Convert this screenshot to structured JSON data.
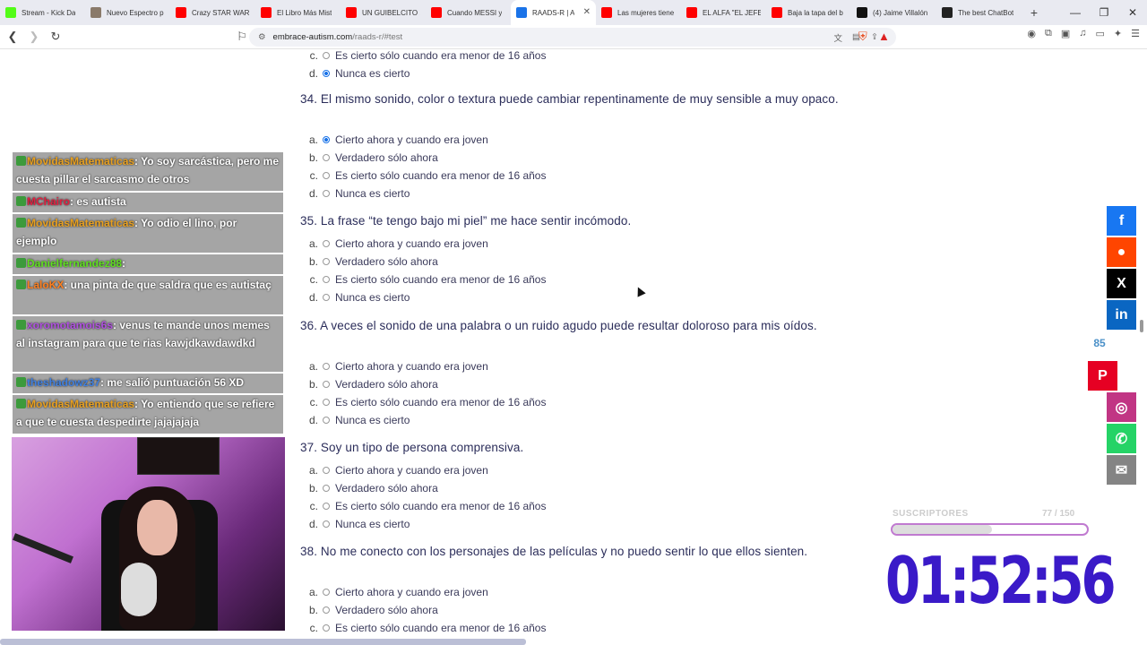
{
  "browser": {
    "tabs": [
      {
        "label": "Stream - Kick Da",
        "favicon_color": "#53fc18",
        "active": false
      },
      {
        "label": "Nuevo Espectro p",
        "favicon_color": "#8a7a6a",
        "active": false
      },
      {
        "label": "Crazy STAR WAR",
        "favicon_color": "#ff0000",
        "active": false
      },
      {
        "label": "El Libro Más Mist",
        "favicon_color": "#ff0000",
        "active": false
      },
      {
        "label": "UN GUIBELCITO !",
        "favicon_color": "#ff0000",
        "active": false
      },
      {
        "label": "Cuando MESSI y",
        "favicon_color": "#ff0000",
        "active": false
      },
      {
        "label": "RAADS-R | A",
        "favicon_color": "#1a73e8",
        "active": true
      },
      {
        "label": "Las mujeres tiene",
        "favicon_color": "#ff0000",
        "active": false
      },
      {
        "label": "EL ALFA \"EL JEFE\"",
        "favicon_color": "#ff0000",
        "active": false
      },
      {
        "label": "Baja la tapa del b",
        "favicon_color": "#ff0000",
        "active": false
      },
      {
        "label": "(4) Jaime Villalón",
        "favicon_color": "#111111",
        "active": false
      },
      {
        "label": "The best ChatBot",
        "favicon_color": "#222222",
        "active": false
      }
    ],
    "new_tab": "+",
    "window_buttons": [
      "—",
      "❐",
      "✕"
    ],
    "url_domain": "embrace-autism.com",
    "url_path": "/raads-r/#test"
  },
  "quiz": {
    "prev_options": [
      {
        "letter": "c.",
        "text": "Es cierto sólo cuando era menor de 16 años",
        "checked": false
      },
      {
        "letter": "d.",
        "text": "Nunca es cierto",
        "checked": true
      }
    ],
    "questions": [
      {
        "text": "34. El mismo sonido, color o textura puede cambiar repentinamente de muy sensible a muy opaco.",
        "options": [
          {
            "letter": "a.",
            "text": "Cierto ahora y cuando era joven",
            "checked": true
          },
          {
            "letter": "b.",
            "text": "Verdadero sólo ahora",
            "checked": false
          },
          {
            "letter": "c.",
            "text": "Es cierto sólo cuando era menor de 16 años",
            "checked": false
          },
          {
            "letter": "d.",
            "text": "Nunca es cierto",
            "checked": false
          }
        ]
      },
      {
        "text": "35. La frase “te tengo bajo mi piel” me hace sentir incómodo.",
        "options": [
          {
            "letter": "a.",
            "text": "Cierto ahora y cuando era joven",
            "checked": false
          },
          {
            "letter": "b.",
            "text": "Verdadero sólo ahora",
            "checked": false
          },
          {
            "letter": "c.",
            "text": "Es cierto sólo cuando era menor de 16 años",
            "checked": false
          },
          {
            "letter": "d.",
            "text": "Nunca es cierto",
            "checked": false
          }
        ]
      },
      {
        "text": "36. A veces el sonido de una palabra o un ruido agudo puede resultar doloroso para mis oídos.",
        "options": [
          {
            "letter": "a.",
            "text": "Cierto ahora y cuando era joven",
            "checked": false
          },
          {
            "letter": "b.",
            "text": "Verdadero sólo ahora",
            "checked": false
          },
          {
            "letter": "c.",
            "text": "Es cierto sólo cuando era menor de 16 años",
            "checked": false
          },
          {
            "letter": "d.",
            "text": "Nunca es cierto",
            "checked": false
          }
        ]
      },
      {
        "text": "37. Soy un tipo de persona comprensiva.",
        "options": [
          {
            "letter": "a.",
            "text": "Cierto ahora y cuando era joven",
            "checked": false
          },
          {
            "letter": "b.",
            "text": "Verdadero sólo ahora",
            "checked": false
          },
          {
            "letter": "c.",
            "text": "Es cierto sólo cuando era menor de 16 años",
            "checked": false
          },
          {
            "letter": "d.",
            "text": "Nunca es cierto",
            "checked": false
          }
        ]
      },
      {
        "text": "38. No me conecto con los personajes de las películas y no puedo sentir lo que ellos sienten.",
        "options": [
          {
            "letter": "a.",
            "text": "Cierto ahora y cuando era joven",
            "checked": false
          },
          {
            "letter": "b.",
            "text": "Verdadero sólo ahora",
            "checked": false
          },
          {
            "letter": "c.",
            "text": "Es cierto sólo cuando era menor de 16 años",
            "checked": false
          }
        ]
      }
    ]
  },
  "chat": [
    {
      "user": "MovidasMatematicas",
      "color": "#e8a020",
      "text": ": Yo soy sarcástica, pero me cuesta pillar el sarcasmo de otros"
    },
    {
      "user": "MChairo",
      "color": "#e02040",
      "text": ": es autista"
    },
    {
      "user": "MovidasMatematicas",
      "color": "#e8a020",
      "text": ": Yo odio el lino, por ejemplo"
    },
    {
      "user": "Danielfernandez88",
      "color": "#60e020",
      "text": ":"
    },
    {
      "user": "LaloKX",
      "color": "#ff8020",
      "text": ": una pinta de que saldra que es autistaç"
    },
    {
      "user": "xoromotamois6s",
      "color": "#b050e0",
      "text": ": venus te mande unos memes al instagram para que te rias kawjdkawdawdkd"
    },
    {
      "user": "theshadowz37",
      "color": "#4080e0",
      "text": ": me salió puntuación 56 XD"
    },
    {
      "user": "MovidasMatematicas",
      "color": "#e8a020",
      "text": ": Yo entiendo que se refiere a que te cuesta despedirte jajajajaja"
    }
  ],
  "share": {
    "buttons": [
      {
        "name": "facebook",
        "color": "#1877f2",
        "glyph": "f"
      },
      {
        "name": "reddit",
        "color": "#ff4500",
        "glyph": "●"
      },
      {
        "name": "x",
        "color": "#000000",
        "glyph": "X"
      },
      {
        "name": "linkedin",
        "color": "#0a66c2",
        "glyph": "in"
      },
      {
        "name": "pinterest",
        "color": "#e60023",
        "glyph": "P"
      },
      {
        "name": "instagram",
        "color": "#c13584",
        "glyph": "◎"
      },
      {
        "name": "whatsapp",
        "color": "#25d366",
        "glyph": "✆"
      },
      {
        "name": "email",
        "color": "#848484",
        "glyph": "✉"
      }
    ],
    "count": "85"
  },
  "overlay": {
    "subs_label": "SUSCRIPTORES",
    "subs_count": "77 / 150",
    "subs_progress": 0.51,
    "timer": "01:52:56"
  }
}
